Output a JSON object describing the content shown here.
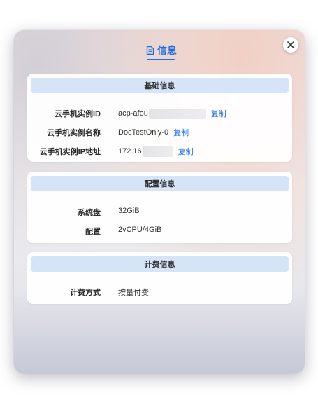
{
  "header": {
    "tab_label": "信息"
  },
  "sections": {
    "basic": {
      "title": "基础信息",
      "rows": [
        {
          "label": "云手机实例ID",
          "value": "acp-afou",
          "copy": "复制"
        },
        {
          "label": "云手机实例名称",
          "value": "DocTestOnly-0",
          "copy": "复制"
        },
        {
          "label": "云手机实例IP地址",
          "value": "172.16",
          "copy": "复制"
        }
      ]
    },
    "config": {
      "title": "配置信息",
      "rows": [
        {
          "label": "系统盘",
          "value": "32GiB"
        },
        {
          "label": "配置",
          "value": "2vCPU/4GiB"
        }
      ]
    },
    "billing": {
      "title": "计费信息",
      "rows": [
        {
          "label": "计费方式",
          "value": "按量付费"
        }
      ]
    }
  },
  "colors": {
    "accent": "#1f6fe0",
    "section_header_bg": "#d6e4f7"
  }
}
